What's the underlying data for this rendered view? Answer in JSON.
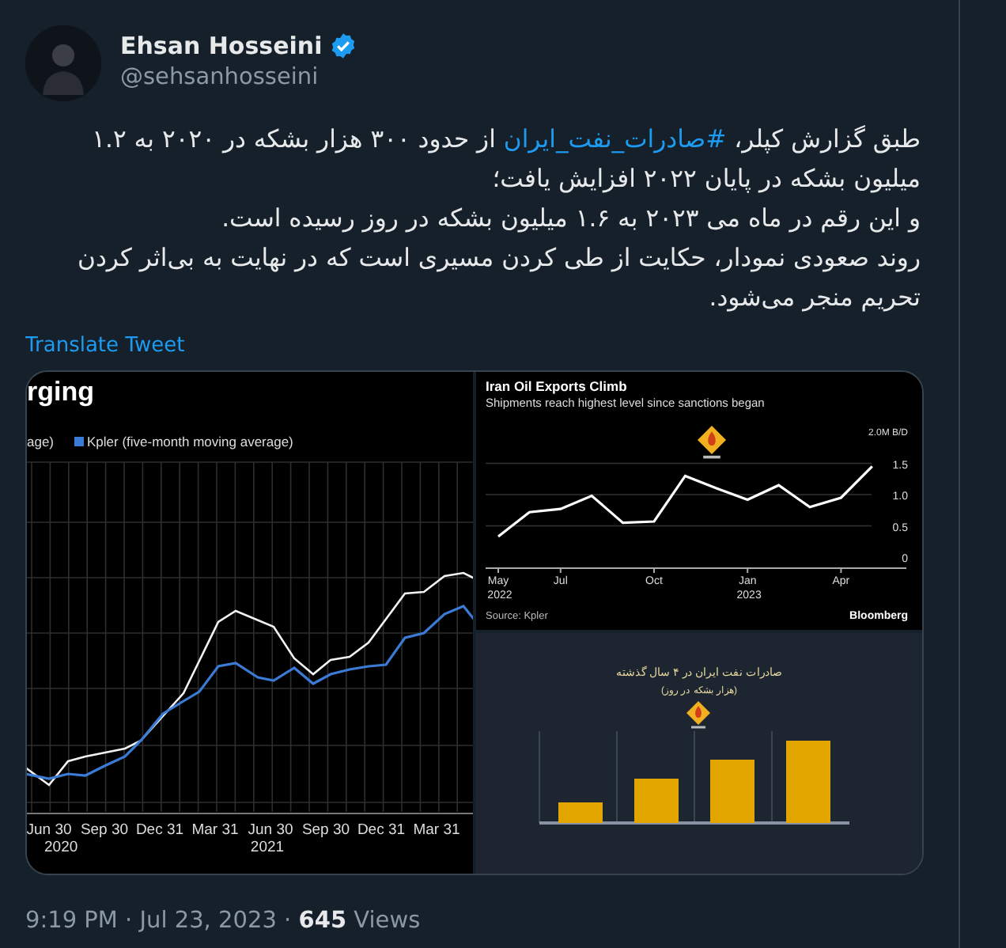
{
  "author": {
    "name": "Ehsan Hosseini",
    "verified": true,
    "handle": "@sehsanhosseini"
  },
  "tweet_text": [
    [
      {
        "kind": "text",
        "text": "طبق گزارش کپلر، "
      },
      {
        "kind": "hashtag",
        "text": "#صادرات_نفت_ایران"
      },
      {
        "kind": "text",
        "text": " از حدود ۳۰۰ هزار بشکه در ۲۰۲۰ به ۱.۲ میلیون بشکه در پایان ۲۰۲۲ افزایش یافت؛"
      }
    ],
    [
      {
        "kind": "text",
        "text": "و این رقم در ماه می ۲۰۲۳ به ۱.۶ میلیون بشکه در روز رسیده است."
      }
    ],
    [
      {
        "kind": "text",
        "text": "روند صعودی نمودار، حکایت از طی کردن مسیری است که در نهایت به بی‌اثر کردن تحریم منجر می‌شود."
      }
    ]
  ],
  "translate_link": "Translate Tweet",
  "media": {
    "left_image": {
      "title": "rging",
      "legend": [
        {
          "label": "age)"
        },
        {
          "label": "Kpler (five-month moving average)",
          "color": "#3a7bd5"
        }
      ],
      "x_labels": [
        "Jun 30",
        "Sep 30",
        "Dec 31",
        "Mar 31",
        "Jun 30",
        "Sep 30",
        "Dec 31",
        "Mar 31"
      ],
      "year_labels": [
        "2020",
        "2021"
      ]
    },
    "top_right_image": {
      "chart_data": {
        "type": "line",
        "title": "Iran Oil Exports Climb",
        "subtitle": "Shipments reach highest level since sanctions began",
        "categories": [
          "May 2022",
          null,
          "Jul",
          null,
          null,
          "Oct",
          null,
          null,
          "Jan 2023",
          null,
          null,
          "Apr",
          null
        ],
        "grid": true,
        "series": [
          {
            "color": "#ffffff",
            "values": [
              0.33,
              0.72,
              0.77,
              0.98,
              0.55,
              0.57,
              1.3,
              1.1,
              0.92,
              1.15,
              0.8,
              0.95,
              1.45
            ]
          }
        ],
        "ylim": [
          0,
          2.0
        ],
        "yticks": [
          {
            "value": 0,
            "label": "0"
          },
          {
            "value": 0.5,
            "label": "0.5"
          },
          {
            "value": 1.0,
            "label": "1.0"
          },
          {
            "value": 1.5,
            "label": "1.5"
          },
          {
            "value": 2.0,
            "label": "2.0M B/D"
          }
        ]
      },
      "source": "Source: Kpler",
      "brand": "Bloomberg"
    },
    "bottom_right_image": {
      "title": "صادرات نفت ایران در ۴ سال گذشته",
      "subtitle": "(هزار بشکه در روز)"
    }
  },
  "footer": {
    "meta": "9:19 PM · Jul 23, 2023 · **645** Views"
  }
}
